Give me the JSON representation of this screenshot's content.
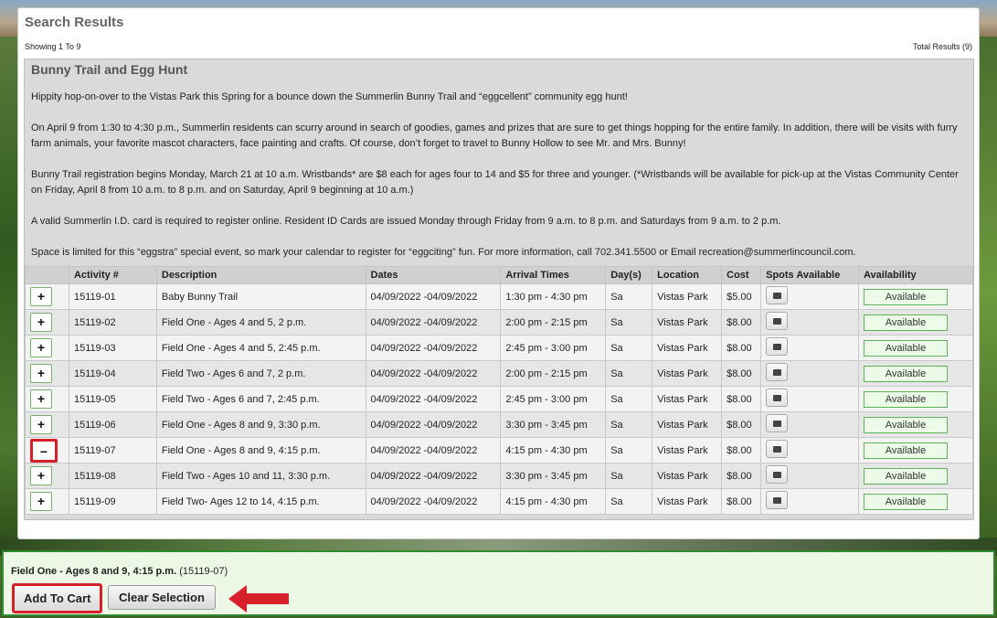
{
  "panel": {
    "title": "Search Results",
    "showing": "Showing 1 To 9",
    "total": "Total Results (9)"
  },
  "activity": {
    "title": "Bunny Trail and Egg Hunt",
    "paragraphs": [
      "Hippity hop-on-over to the Vistas Park this Spring for a bounce down the Summerlin Bunny Trail and “eggcellent” community egg hunt!",
      "On April 9 from 1:30 to 4:30 p.m., Summerlin residents can scurry around in search of goodies, games and prizes that are sure to get things hopping for the entire family. In addition, there will be visits with furry farm animals, your favorite mascot characters, face painting and crafts. Of course, don’t forget to travel to Bunny Hollow to see Mr. and Mrs. Bunny!",
      "Bunny Trail registration begins Monday, March 21 at 10 a.m. Wristbands* are $8 each for ages four to 14 and $5 for three and younger. (*Wristbands will be available for pick-up at the Vistas Community Center on Friday, April 8 from 10 a.m. to 8 p.m. and on Saturday, April 9 beginning at 10 a.m.)",
      "A valid Summerlin I.D. card is required to register online. Resident ID Cards are issued Monday through Friday from 9 a.m. to 8 p.m. and Saturdays from 9 a.m. to 2 p.m.",
      "Space is limited for this “eggstra” special event, so mark your calendar to register for “eggciting” fun. For more information, call 702.341.5500 or Email recreation@summerlincouncil.com."
    ]
  },
  "table": {
    "headers": [
      "",
      "Activity #",
      "Description",
      "Dates",
      "Arrival Times",
      "Day(s)",
      "Location",
      "Cost",
      "Spots Available",
      "Availability"
    ],
    "rows": [
      {
        "selected": false,
        "activity": "15119-01",
        "description": "Baby Bunny Trail",
        "dates": "04/09/2022 -04/09/2022",
        "arrival": "1:30 pm - 4:30 pm",
        "days": "Sa",
        "location": "Vistas Park",
        "cost": "$5.00",
        "availability": "Available"
      },
      {
        "selected": false,
        "activity": "15119-02",
        "description": "Field One - Ages 4 and 5, 2 p.m.",
        "dates": "04/09/2022 -04/09/2022",
        "arrival": "2:00 pm - 2:15 pm",
        "days": "Sa",
        "location": "Vistas Park",
        "cost": "$8.00",
        "availability": "Available"
      },
      {
        "selected": false,
        "activity": "15119-03",
        "description": "Field One - Ages 4 and 5, 2:45 p.m.",
        "dates": "04/09/2022 -04/09/2022",
        "arrival": "2:45 pm - 3:00 pm",
        "days": "Sa",
        "location": "Vistas Park",
        "cost": "$8.00",
        "availability": "Available"
      },
      {
        "selected": false,
        "activity": "15119-04",
        "description": "Field Two - Ages 6 and 7, 2 p.m.",
        "dates": "04/09/2022 -04/09/2022",
        "arrival": "2:00 pm - 2:15 pm",
        "days": "Sa",
        "location": "Vistas Park",
        "cost": "$8.00",
        "availability": "Available"
      },
      {
        "selected": false,
        "activity": "15119-05",
        "description": "Field Two - Ages 6 and 7, 2:45 p.m.",
        "dates": "04/09/2022 -04/09/2022",
        "arrival": "2:45 pm - 3:00 pm",
        "days": "Sa",
        "location": "Vistas Park",
        "cost": "$8.00",
        "availability": "Available"
      },
      {
        "selected": false,
        "activity": "15119-06",
        "description": "Field One - Ages 8 and 9, 3:30 p.m.",
        "dates": "04/09/2022 -04/09/2022",
        "arrival": "3:30 pm - 3:45 pm",
        "days": "Sa",
        "location": "Vistas Park",
        "cost": "$8.00",
        "availability": "Available"
      },
      {
        "selected": true,
        "activity": "15119-07",
        "description": "Field One - Ages 8 and 9, 4:15 p.m.",
        "dates": "04/09/2022 -04/09/2022",
        "arrival": "4:15 pm - 4:30 pm",
        "days": "Sa",
        "location": "Vistas Park",
        "cost": "$8.00",
        "availability": "Available"
      },
      {
        "selected": false,
        "activity": "15119-08",
        "description": "Field Two - Ages 10 and 11, 3:30 p.m.",
        "dates": "04/09/2022 -04/09/2022",
        "arrival": "3:30 pm - 3:45 pm",
        "days": "Sa",
        "location": "Vistas Park",
        "cost": "$8.00",
        "availability": "Available"
      },
      {
        "selected": false,
        "activity": "15119-09",
        "description": "Field Two- Ages 12 to 14, 4:15 p.m.",
        "dates": "04/09/2022 -04/09/2022",
        "arrival": "4:15 pm - 4:30 pm",
        "days": "Sa",
        "location": "Vistas Park",
        "cost": "$8.00",
        "availability": "Available"
      }
    ],
    "add_symbol": "+",
    "remove_symbol": "−"
  },
  "selection": {
    "name": "Field One - Ages 8 and 9, 4:15 p.m.",
    "code": "(15119-07)",
    "add_to_cart_label": "Add To Cart",
    "clear_selection_label": "Clear Selection"
  },
  "colors": {
    "highlight_red": "#d6202a",
    "available_green": "#5fb15a",
    "bottom_border_green": "#2e8b2e"
  },
  "icons": {
    "spots": "calendar-icon",
    "arrow": "left-arrow-icon"
  }
}
